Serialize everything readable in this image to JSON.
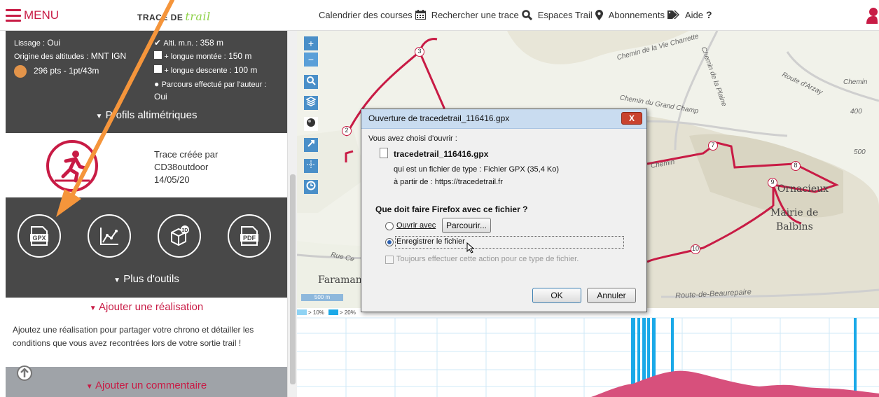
{
  "topbar": {
    "menu_label": "MENU",
    "logo_text": "TRACE DE",
    "logo_script": "trail",
    "nav": [
      {
        "label": "Calendrier des courses",
        "icon": "calendar-icon"
      },
      {
        "label": "Rechercher une trace",
        "icon": "search-icon"
      },
      {
        "label": "Espaces Trail",
        "icon": "map-pin-icon"
      },
      {
        "label": "Abonnements",
        "icon": "tag-icon"
      },
      {
        "label": "Aide",
        "icon": "question-icon"
      }
    ],
    "colors": {
      "accent": "#c81b45"
    }
  },
  "stats": {
    "lissage_label": "Lissage :",
    "lissage_value": "Oui",
    "origine_label": "Origine des altitudes :",
    "origine_value": "MNT IGN",
    "points": "296 pts - 1pt/43m",
    "alti_label": "Alti. m.n. :",
    "alti_value": "358 m",
    "montee_label": "+ longue montée :",
    "montee_value": "150 m",
    "descente_label": "+ longue descente :",
    "descente_value": "100 m",
    "auteur_label": "Parcours effectué par l'auteur :",
    "auteur_value": "Oui",
    "profils_label": "Profils altimétriques"
  },
  "author": {
    "line1": "Trace créée par",
    "line2": "CD38outdoor",
    "line3": "14/05/20"
  },
  "tools": {
    "gpx": "GPX",
    "pdf": "PDF",
    "threed": "3D",
    "plus_outils": "Plus d'outils"
  },
  "realisation": {
    "title": "Ajouter une réalisation",
    "text": "Ajoutez une réalisation pour partager votre chrono et détailler les conditions que vous avez recontrées lors de votre sortie trail !"
  },
  "comment": {
    "title": "Ajouter un commentaire"
  },
  "map": {
    "places": [
      "Ornacieux",
      "Mairie de",
      "Balbins",
      "Faraman"
    ],
    "roads": [
      "Chemin de la Vie Charrette",
      "Chemin de la Plaine",
      "Route d'Arzay",
      "Chemin du Grand Champ",
      "Chemin",
      "Route-de-Beaurepaire",
      "Rue Ce",
      "Chemin"
    ],
    "contours": [
      "400",
      "500"
    ],
    "scale": "500 m",
    "waypoints": [
      "2",
      "3",
      "7",
      "8",
      "9",
      "10"
    ],
    "tool_plus": "+",
    "tool_minus": "−"
  },
  "profile": {
    "legend": [
      "> 10%",
      "> 20%"
    ],
    "colors": {
      "slope10": "#8fd3f4",
      "slope20": "#1aa9e8",
      "elevation": "#d7507c"
    }
  },
  "dialog": {
    "title": "Ouverture de tracedetrail_116416.gpx",
    "close": "X",
    "intro": "Vous avez choisi d'ouvrir :",
    "filename": "tracedetrail_116416.gpx",
    "type_line": "qui est un fichier de type : Fichier GPX (35,4 Ko)",
    "source_line": "à partir de : https://tracedetrail.fr",
    "question": "Que doit faire Firefox avec ce fichier ?",
    "open_with": "Ouvrir avec",
    "browse": "Parcourir...",
    "save_file": "Enregistrer le fichier",
    "always": "Toujours effectuer cette action pour ce type de fichier.",
    "ok": "OK",
    "cancel": "Annuler"
  }
}
